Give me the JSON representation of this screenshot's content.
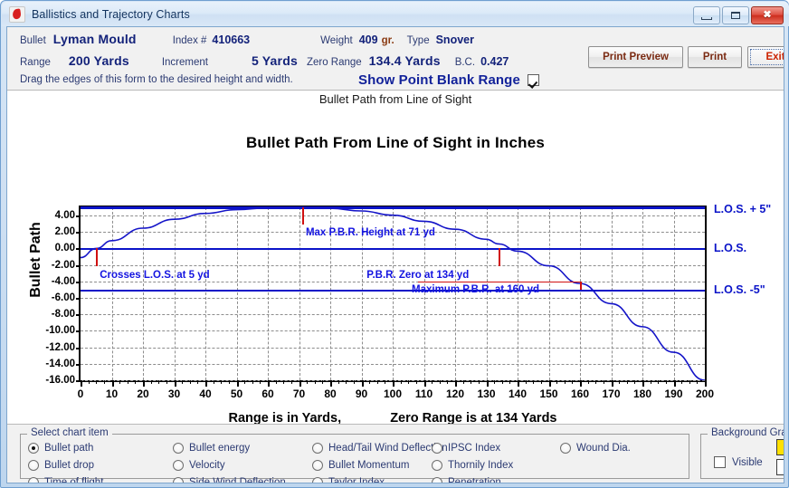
{
  "window": {
    "title": "Ballistics and Trajectory Charts",
    "icon": "app-flame-icon",
    "minimize_glyph": "",
    "restore_glyph": "",
    "close_glyph": "✖"
  },
  "header": {
    "bullet_label": "Bullet",
    "bullet_value": "Lyman Mould",
    "index_label": "Index #",
    "index_value": "410663",
    "weight_label": "Weight",
    "weight_value": "409",
    "weight_unit": "gr.",
    "type_label": "Type",
    "type_value": "Snover",
    "range_label": "Range",
    "range_value": "200 Yards",
    "increment_label": "Increment",
    "increment_value": "5 Yards",
    "zero_range_label": "Zero Range",
    "zero_range_value": "134.4 Yards",
    "bc_label": "B.C.",
    "bc_value": "0.427",
    "hint": "Drag the edges of this form to the desired height and width.",
    "show_pbr_label": "Show Point Blank Range",
    "show_pbr_checked": true,
    "buttons": {
      "print_preview": "Print Preview",
      "print": "Print",
      "exit": "Exit"
    }
  },
  "chart_data": {
    "type": "line",
    "subcaption": "Bullet Path from Line of Sight",
    "title": "Bullet Path From Line of Sight in Inches",
    "ylabel": "Bullet Path",
    "xlabel_part1": "Range is in Yards,",
    "xlabel_part2": "Zero Range is at  134 Yards",
    "xlim": [
      0,
      200
    ],
    "ylim": [
      -16,
      5
    ],
    "grid": true,
    "xticks": [
      0,
      10,
      20,
      30,
      40,
      50,
      60,
      70,
      80,
      90,
      100,
      110,
      120,
      130,
      140,
      150,
      160,
      170,
      180,
      190,
      200
    ],
    "yticks": [
      4.0,
      2.0,
      0.0,
      -2.0,
      -4.0,
      -6.0,
      -8.0,
      -10.0,
      -12.0,
      -14.0,
      -16.0
    ],
    "ytick_labels": [
      "4.00",
      "2.00",
      "0.00",
      "-2.00",
      "-4.00",
      "-6.00",
      "-8.00",
      "-10.00",
      "-12.00",
      "-14.00",
      "-16.00"
    ],
    "series": [
      {
        "name": "Bullet path",
        "color": "#1414c8",
        "x": [
          0,
          5,
          10,
          20,
          30,
          40,
          50,
          60,
          70,
          80,
          90,
          100,
          110,
          120,
          130,
          134,
          140,
          150,
          160,
          170,
          180,
          190,
          200
        ],
        "y": [
          -1.1,
          0.0,
          0.95,
          2.47,
          3.55,
          4.26,
          4.72,
          4.93,
          5.0,
          4.88,
          4.56,
          4.05,
          3.3,
          2.34,
          1.12,
          0.55,
          -0.32,
          -2.1,
          -4.25,
          -6.7,
          -9.5,
          -12.6,
          -16.0
        ]
      }
    ],
    "reference_lines": [
      {
        "name": "L.O.S. + 5\"",
        "y": 5.0,
        "color": "#0b14c8"
      },
      {
        "name": "L.O.S.",
        "y": 0.0,
        "color": "#0b14c8"
      },
      {
        "name": "L.O.S. -5\"",
        "y": -5.0,
        "color": "#0b14c8"
      }
    ],
    "annotations": [
      {
        "text": "Crosses L.O.S. at 5  yd",
        "x": 5,
        "y": -2.6,
        "marker_x": 5,
        "color": "#1414e0"
      },
      {
        "text": "Max P.B.R. Height at 71  yd",
        "x": 71,
        "y": 2.6,
        "marker_x": 71,
        "color": "#1414e0"
      },
      {
        "text": "P.B.R. Zero at 134  yd",
        "x": 134,
        "y": -2.6,
        "marker_x": 134,
        "color": "#1414e0"
      },
      {
        "text": "Maximum P.B.R. at 160  yd",
        "x": 160,
        "y": -4.3,
        "marker_x": 160,
        "color": "#1414e0"
      }
    ],
    "marker_color": "#d01010"
  },
  "bottom": {
    "chart_item_group": "Select chart item",
    "items": [
      {
        "label": "Bullet path",
        "selected": true
      },
      {
        "label": "Bullet drop",
        "selected": false
      },
      {
        "label": "Time of flight",
        "selected": false
      },
      {
        "label": "Bullet energy",
        "selected": false
      },
      {
        "label": "Velocity",
        "selected": false
      },
      {
        "label": "Side Wind Deflection",
        "selected": false
      },
      {
        "label": "Head/Tail Wind Deflection",
        "selected": false
      },
      {
        "label": "Bullet Momentum",
        "selected": false
      },
      {
        "label": "Taylor Index",
        "selected": false
      },
      {
        "label": "IPSC Index",
        "selected": false
      },
      {
        "label": "Thornily Index",
        "selected": false
      },
      {
        "label": "Penetration",
        "selected": false
      },
      {
        "label": "Wound Dia.",
        "selected": false
      }
    ],
    "bg_gradient_group": "Background Gradient",
    "bg_visible_label": "Visible",
    "bg_visible_checked": false,
    "swatch_top_color": "#ffe000",
    "swatch_bottom_color": "#ffffff"
  }
}
